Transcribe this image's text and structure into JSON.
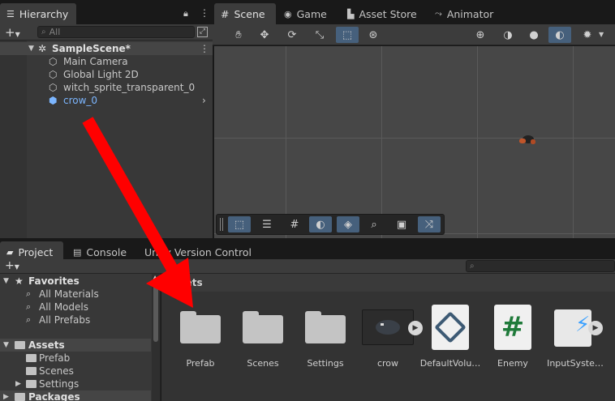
{
  "hierarchy": {
    "tab_label": "Hierarchy",
    "search_placeholder": "All",
    "scene_name": "SampleScene*",
    "objects": [
      "Main Camera",
      "Global Light 2D",
      "witch_sprite_transparent_0",
      "crow_0"
    ]
  },
  "scene_tabs": [
    "Scene",
    "Game",
    "Asset Store",
    "Animator"
  ],
  "project_tabs": [
    "Project",
    "Console",
    "Unity Version Control"
  ],
  "favorites": {
    "label": "Favorites",
    "items": [
      "All Materials",
      "All Models",
      "All Prefabs"
    ]
  },
  "assets_tree": {
    "label": "Assets",
    "items": [
      "Prefab",
      "Scenes",
      "Settings"
    ],
    "packages_label": "Packages"
  },
  "assets_panel": {
    "header": "Assets",
    "items": [
      "Prefab",
      "Scenes",
      "Settings",
      "crow",
      "DefaultVolu…",
      "Enemy",
      "InputSyste…"
    ]
  },
  "colors": {
    "arrow": "#ff0000",
    "selection_blue": "#7cb6ff",
    "active_tool": "#46607c"
  }
}
